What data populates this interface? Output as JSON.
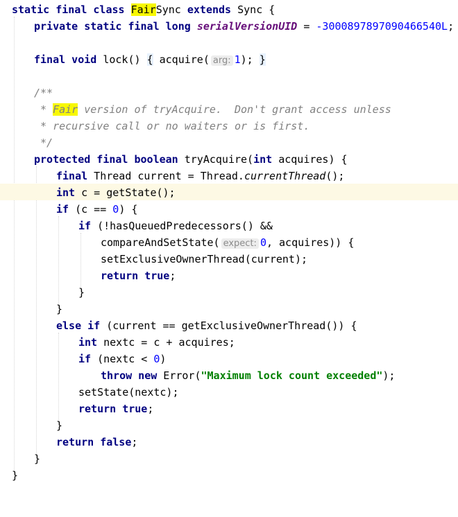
{
  "editor": {
    "class_decl": {
      "kw": "static final class",
      "name_highlight": "Fair",
      "name_rest": "Sync",
      "extends_kw": "extends",
      "base": "Sync {"
    },
    "serial": {
      "kw": "private static final long",
      "field": "serialVersionUID",
      "eq": " = ",
      "value": "-3000897897090466540L",
      "end": ";"
    },
    "lock": {
      "kw": "final void",
      "sig": " lock() ",
      "open": "{",
      "call": " acquire(",
      "hint": "arg:",
      "value": "1",
      "close_call": "); ",
      "close": "}"
    },
    "javadoc": {
      "line1": "/**",
      "line2_prefix": " * ",
      "line2_highlight": "Fair",
      "line2_rest": " version of tryAcquire.  Don't grant access unless",
      "line3": " * recursive call or no waiters or is first.",
      "line4": " */"
    },
    "try_acquire": {
      "kw": "protected final boolean",
      "sig": " tryAcquire(",
      "param_kw": "int",
      "param": " acquires) {"
    },
    "current_thread": {
      "kw": "final",
      "text": " Thread current = Thread.",
      "method": "currentThread",
      "end": "();"
    },
    "get_state": {
      "kw": "int",
      "text": " c = getState();"
    },
    "if_c": {
      "kw": "if",
      "text1": " (c == ",
      "value": "0",
      "text2": ") {"
    },
    "if_queued": {
      "kw": "if",
      "text": " (!hasQueuedPredecessors() &&"
    },
    "cas": {
      "text1": "compareAndSetState(",
      "hint": "expect:",
      "value": "0",
      "text2": ", acquires)) {"
    },
    "set_owner": "setExclusiveOwnerThread(current);",
    "return_true_1": {
      "kw": "return true",
      "end": ";"
    },
    "close_inner": "}",
    "close_if": "}",
    "else_if": {
      "kw": "else if",
      "text": " (current == getExclusiveOwnerThread()) {"
    },
    "nextc": {
      "kw": "int",
      "text": " nextc = c + acquires;"
    },
    "if_nextc": {
      "kw": "if",
      "text1": " (nextc < ",
      "value": "0",
      "text2": ")"
    },
    "throw": {
      "kw": "throw new",
      "text1": " Error(",
      "str": "\"Maximum lock count exceeded\"",
      "text2": ");"
    },
    "set_state": "setState(nextc);",
    "return_true_2": {
      "kw": "return true",
      "end": ";"
    },
    "close_else": "}",
    "return_false": {
      "kw": "return false",
      "end": ";"
    },
    "close_method": "}",
    "close_class": "}"
  }
}
